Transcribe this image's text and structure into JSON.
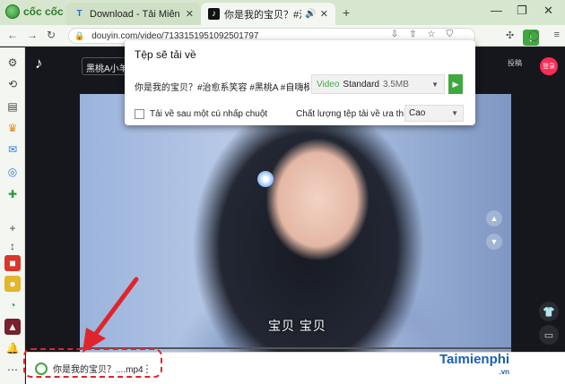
{
  "browser": {
    "brand": "cốc cốc",
    "tabs": [
      {
        "label": "Download - Tải Miễn Phí VN",
        "favicon": "T"
      },
      {
        "label": "你是我的宝贝？#治愈系",
        "favicon": "♪"
      }
    ],
    "url": "douyin.com/video/7133151951092501797"
  },
  "page": {
    "search_text": "黑桃A小羊",
    "logo": "♪",
    "right_labels": [
      "",
      "投稿"
    ],
    "login_label": "登录",
    "subtitle": "宝贝 宝贝"
  },
  "popup": {
    "title": "Tệp sẽ tải về",
    "file_name": "你是我的宝贝？#治愈系笑容 #黑桃A #自嗨模...",
    "quality_tag": "Video",
    "quality_label": "Standard",
    "quality_size": "3.5MB",
    "checkbox_label": "Tải về sau một cú nhấp chuột",
    "preference_label": "Chất lượng tệp tải về ưa thích",
    "preference_value": "Cao"
  },
  "download_bar": {
    "file_name": "你是我的宝贝？....mp4"
  },
  "watermark": {
    "text": "Taimienphi",
    "suffix": ".vn"
  },
  "colors": {
    "accent_green": "#3fa83f",
    "highlight_red": "#e0242b"
  }
}
